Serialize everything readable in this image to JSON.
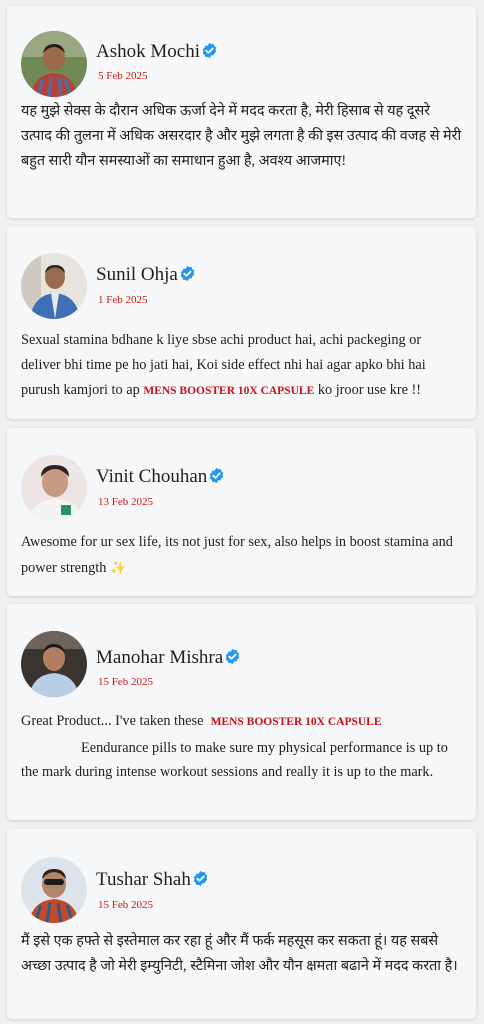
{
  "reviews": [
    {
      "name": "Ashok Mochi",
      "date": "5 Feb 2025",
      "text": "यह मुझे सेक्स के दौरान अधिक ऊर्जा देने में मदद करता है, मेरी हिसाब से यह दूसरे उत्पाद की तुलना में अधिक असरदार है और मुझे लगता है की इस उत्पाद की वजह से मेरी बहुत सारी यौन समस्याओं का समाधान हुआ है, अवश्य आजमाए!"
    },
    {
      "name": "Sunil Ohja",
      "date": "1 Feb 2025",
      "text_before": "Sexual stamina bdhane k liye sbse achi product hai, achi packeging or deliver bhi time pe ho jati hai, Koi side effect nhi hai agar apko bhi hai purush kamjori to ap ",
      "product": "MENS BOOSTER 10X CAPSULE",
      "text_after": " ko jroor use kre !!"
    },
    {
      "name": "Vinit Chouhan",
      "date": "13 Feb 2025",
      "text": "Awesome for ur sex life, its not just for sex, also helps in boost stamina and power strength",
      "emoji": "✨"
    },
    {
      "name": "Manohar Mishra",
      "date": "15 Feb 2025",
      "text_before": "Great Product... I've taken these",
      "product": "MENS BOOSTER 10X CAPSULE",
      "text_after": "Eendurance pills to make sure my physical performance is up to the mark during intense workout sessions and really it is up to the mark."
    },
    {
      "name": "Tushar Shah",
      "date": "15 Feb 2025",
      "text": "मैं इसे एक हफ्ते से इस्तेमाल कर रहा हूं और मैं फर्क महसूस कर सकता हूं। यह सबसे अच्छा उत्पाद है जो मेरी इम्युनिटी, स्टैमिना जोश और यौन क्षमता बढाने में मदद करता है।"
    }
  ],
  "colors": {
    "date": "#d01818",
    "product": "#c8101a",
    "verified": "#2196f3"
  },
  "icons": [
    "verified-badge-icon",
    "sparkles-emoji"
  ]
}
